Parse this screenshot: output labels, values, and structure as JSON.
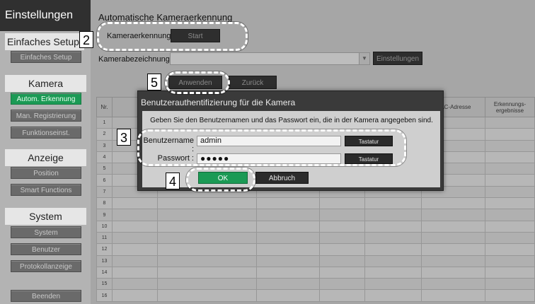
{
  "sidebar": {
    "app_title": "Einstellungen",
    "simple_heading": "Einfaches Setup",
    "simple_btn": "Einfaches Setup",
    "camera_heading": "Kamera",
    "auto_detect": "Autom. Erkennung",
    "manual_reg": "Man. Registrierung",
    "function_settings": "Funktionseinst.",
    "display_heading": "Anzeige",
    "position": "Position",
    "smart_functions": "Smart Functions",
    "system_heading": "System",
    "system_btn": "System",
    "user_btn": "Benutzer",
    "log_btn": "Protokollanzeige",
    "exit_btn": "Beenden"
  },
  "main": {
    "title": "Automatische Kameraerkennung",
    "detect_label": "Kameraerkennung",
    "start_btn": "Start",
    "camera_name_label": "Kamerabezeichnung",
    "settings_btn": "Einstellungen",
    "apply_btn": "Anwenden",
    "back_btn": "Zurück"
  },
  "table": {
    "col_nr": "Nr.",
    "col_mac": "MAC-Adresse",
    "col_result": "Erkennungs-ergebnisse",
    "rows": [
      "1",
      "2",
      "3",
      "4",
      "5",
      "6",
      "7",
      "8",
      "9",
      "10",
      "11",
      "12",
      "13",
      "14",
      "15",
      "16"
    ]
  },
  "dialog": {
    "title": "Benutzerauthentifizierung für die Kamera",
    "message": "Geben Sie den Benutzernamen und das Passwort ein, die in der Kamera angegeben sind.",
    "username_label": "Benutzername :",
    "username_value": "admin",
    "password_label": "Passwort :",
    "password_value": "●●●●●",
    "keyboard_btn": "Tastatur",
    "ok_btn": "OK",
    "cancel_btn": "Abbruch"
  },
  "callouts": [
    "2",
    "3",
    "4",
    "5"
  ]
}
